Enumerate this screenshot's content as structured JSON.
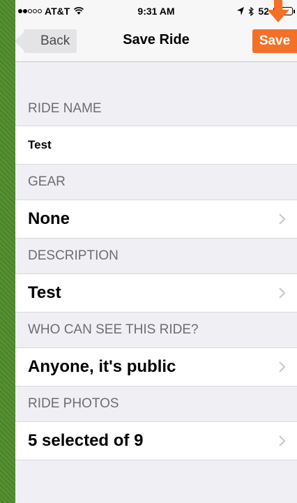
{
  "status_bar": {
    "carrier": "AT&T",
    "time": "9:31 AM",
    "battery_text": "52",
    "battery_level": 0.52,
    "icons": [
      "signal-icon",
      "wifi-icon",
      "location-icon",
      "bluetooth-icon",
      "battery-icon"
    ]
  },
  "nav": {
    "back_label": "Back",
    "title": "Save Ride",
    "save_label": "Save",
    "save_color": "#f37028"
  },
  "sections": {
    "ride_name_header": "RIDE NAME",
    "ride_name_value": "Test",
    "gear_header": "GEAR",
    "gear_value": "None",
    "description_header": "DESCRIPTION",
    "description_value": "Test",
    "visibility_header": "WHO CAN SEE THIS RIDE?",
    "visibility_value": "Anyone, it's public",
    "photos_header": "RIDE PHOTOS",
    "photos_value": "5 selected of 9"
  },
  "colors": {
    "accent": "#f37028",
    "background": "#efeff4",
    "header_text": "#6d6d72",
    "chevron": "#c7c7cc"
  }
}
